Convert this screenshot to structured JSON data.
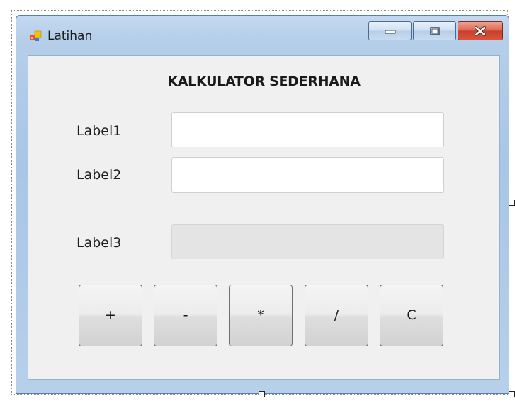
{
  "window": {
    "title": "Latihan",
    "caption_buttons": {
      "minimize_icon": "minimize-icon",
      "maximize_icon": "maximize-icon",
      "close_icon": "close-icon"
    }
  },
  "form": {
    "heading": "KALKULATOR SEDERHANA",
    "label1": "Label1",
    "label2": "Label2",
    "label3": "Label3",
    "input1_value": "",
    "input2_value": "",
    "result_value": ""
  },
  "buttons": {
    "add": "+",
    "subtract": "-",
    "multiply": "*",
    "divide": "/",
    "clear": "C"
  },
  "colors": {
    "close_button": "#c8402a",
    "client_background": "#f0f0f0",
    "frame_accent": "#a9c6e6"
  }
}
